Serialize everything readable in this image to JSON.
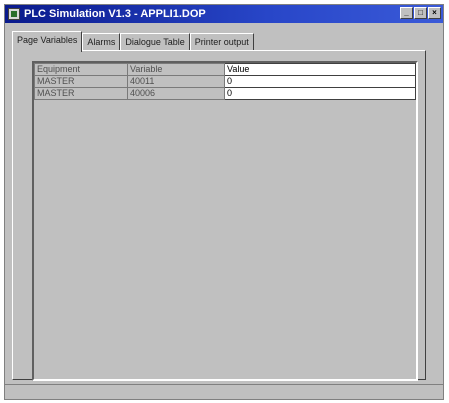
{
  "window": {
    "title": "PLC Simulation V1.3 - APPLI1.DOP",
    "controls": {
      "minimize": "_",
      "maximize": "□",
      "close": "×"
    }
  },
  "tabs": [
    {
      "label": "Page Variables",
      "active": true
    },
    {
      "label": "Alarms",
      "active": false
    },
    {
      "label": "Dialogue Table",
      "active": false
    },
    {
      "label": "Printer output",
      "active": false
    }
  ],
  "grid": {
    "headers": [
      "Equipment",
      "Variable",
      "Value"
    ],
    "rows": [
      {
        "equipment": "MASTER",
        "variable": "40011",
        "value": "0"
      },
      {
        "equipment": "MASTER",
        "variable": "40006",
        "value": "0"
      }
    ]
  },
  "colors": {
    "titlebar_start": "#0a1a8c",
    "titlebar_end": "#3a5ad8",
    "face": "#c0c0c0"
  }
}
